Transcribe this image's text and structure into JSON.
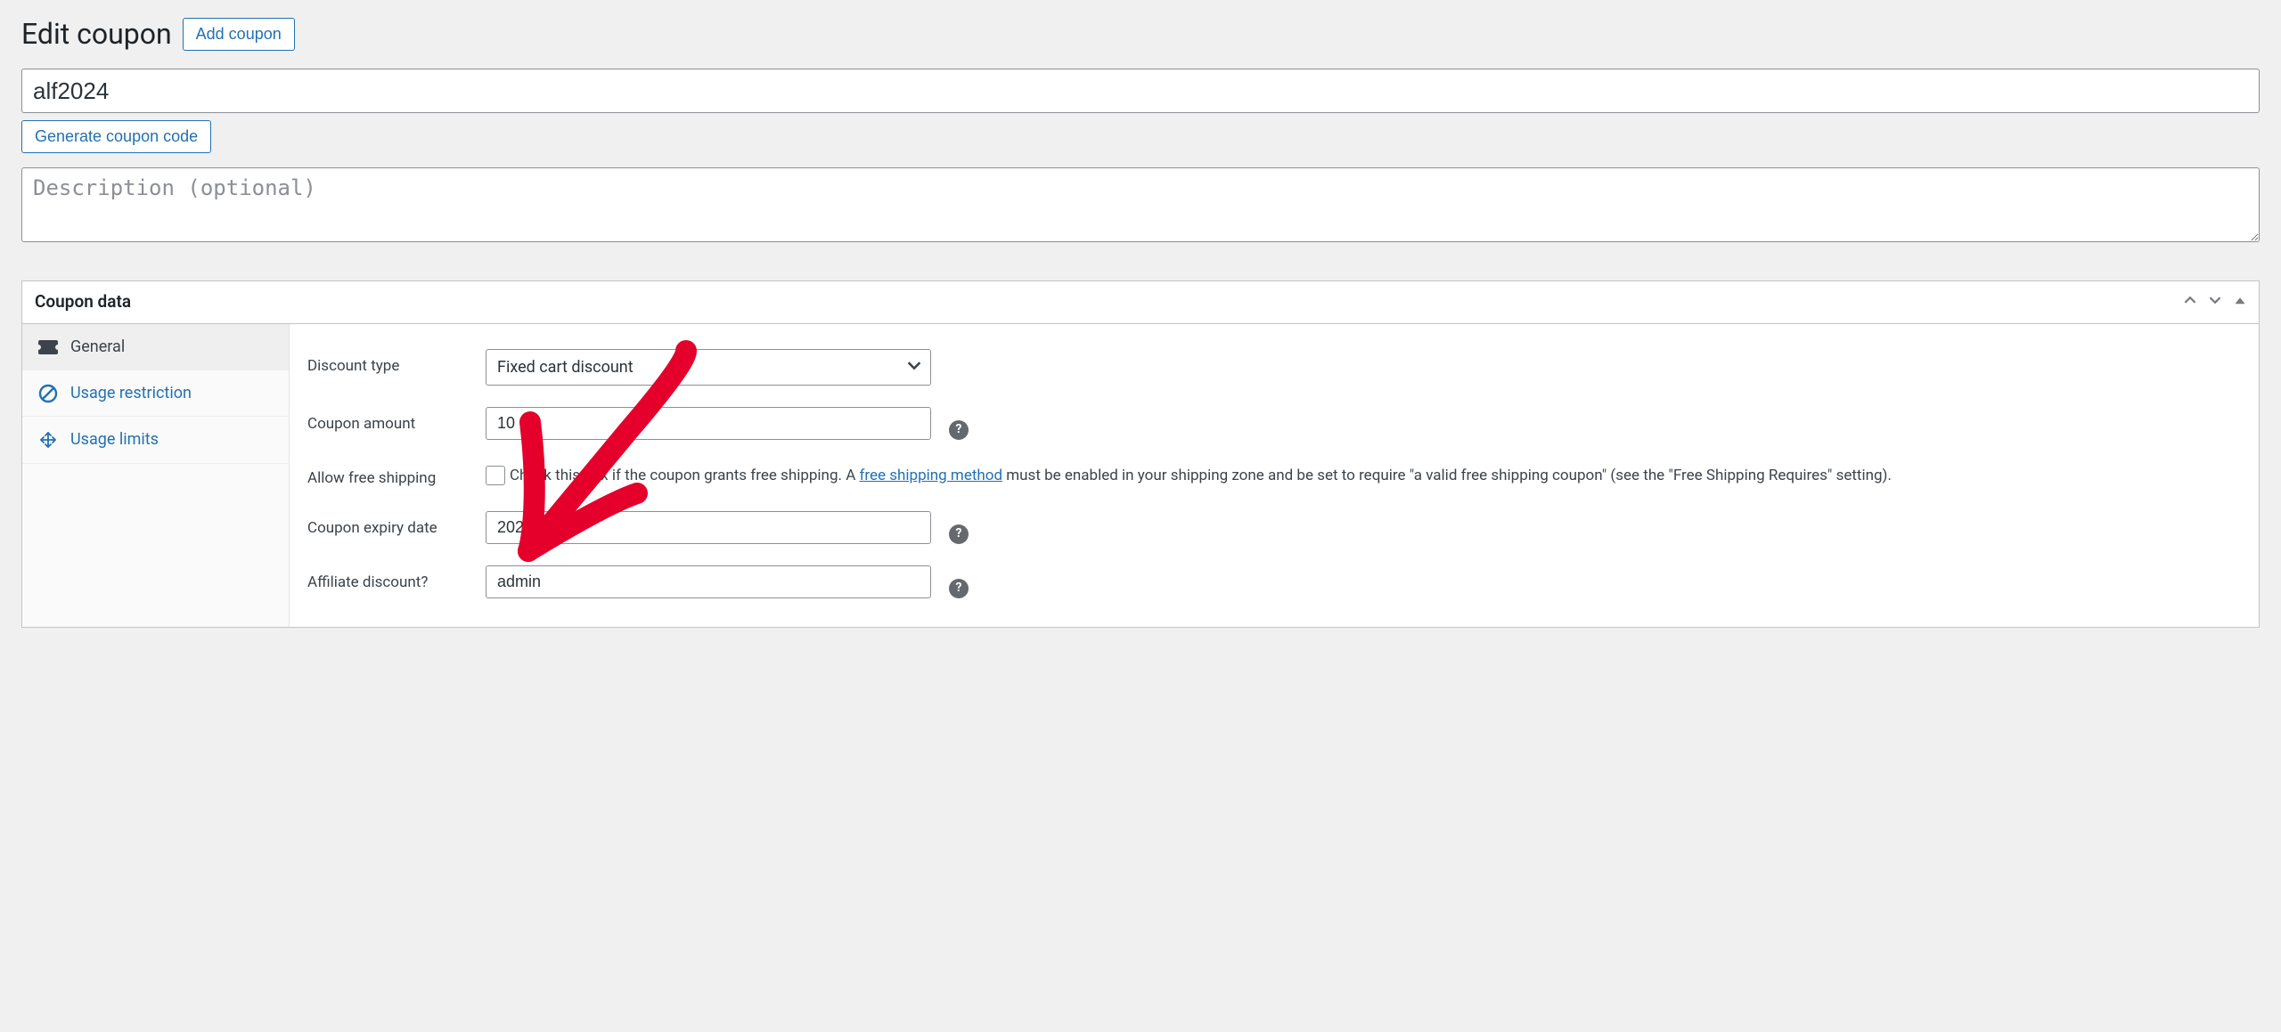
{
  "header": {
    "title": "Edit coupon",
    "add_button": "Add coupon"
  },
  "coupon_code": "alf2024",
  "generate_button": "Generate coupon code",
  "description_placeholder": "Description (optional)",
  "panel": {
    "title": "Coupon data",
    "tabs": [
      {
        "key": "general",
        "label": "General"
      },
      {
        "key": "usage_restriction",
        "label": "Usage restriction"
      },
      {
        "key": "usage_limits",
        "label": "Usage limits"
      }
    ]
  },
  "fields": {
    "discount_type": {
      "label": "Discount type",
      "value": "Fixed cart discount"
    },
    "coupon_amount": {
      "label": "Coupon amount",
      "value": "10"
    },
    "allow_free_shipping": {
      "label": "Allow free shipping",
      "desc_pre": "Check this box if the coupon grants free shipping. A ",
      "link_text": "free shipping method",
      "desc_post": " must be enabled in your shipping zone and be set to require \"a valid free shipping coupon\" (see the \"Free Shipping Requires\" setting)."
    },
    "expiry_date": {
      "label": "Coupon expiry date",
      "value": "2024-05-31"
    },
    "affiliate": {
      "label": "Affiliate discount?",
      "value": "admin"
    }
  }
}
